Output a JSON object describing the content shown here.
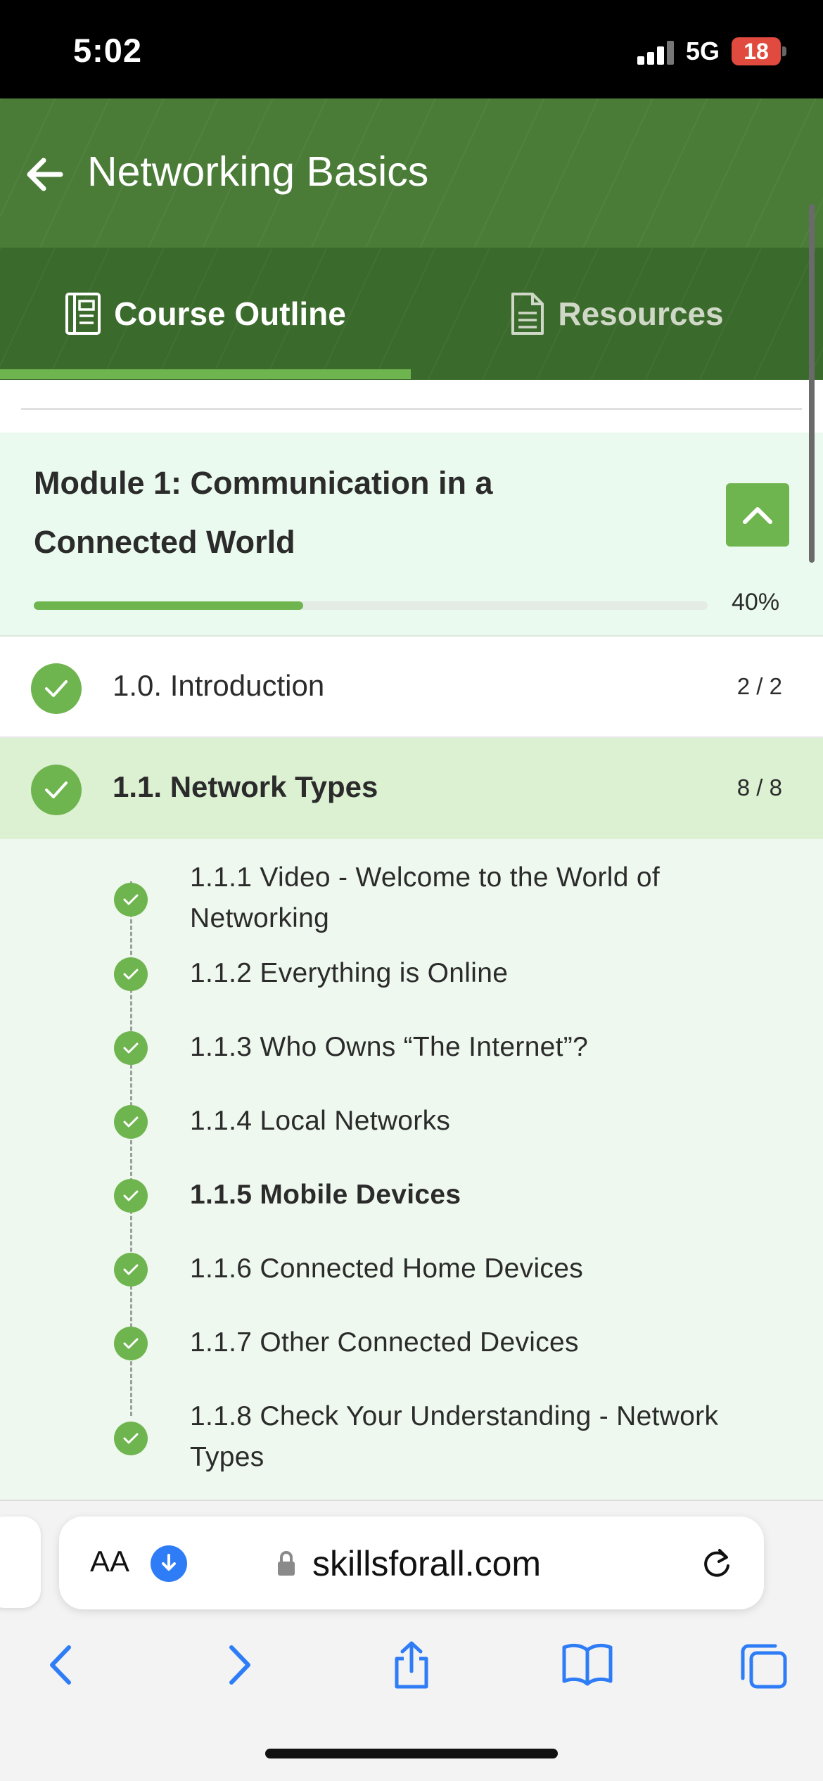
{
  "status_bar": {
    "time": "5:02",
    "network": "5G",
    "battery": "18"
  },
  "header": {
    "title": "Networking Basics"
  },
  "tabs": [
    {
      "label": "Course Outline",
      "icon": "course-outline-icon",
      "active": true
    },
    {
      "label": "Resources",
      "icon": "document-icon",
      "active": false
    }
  ],
  "module": {
    "title": "Module 1: Communication in a Connected World",
    "progress_percent": 40,
    "progress_label": "40%"
  },
  "sections": [
    {
      "title": "1.0. Introduction",
      "count": "2 / 2",
      "completed": true
    },
    {
      "title": "1.1. Network Types",
      "count": "8 / 8",
      "completed": true,
      "expanded": true
    }
  ],
  "sub_items": [
    {
      "label": "1.1.1 Video - Welcome to the World of Networking",
      "completed": true
    },
    {
      "label": "1.1.2 Everything is Online",
      "completed": true
    },
    {
      "label": "1.1.3 Who Owns “The Internet”?",
      "completed": true
    },
    {
      "label": "1.1.4 Local Networks",
      "completed": true
    },
    {
      "label": "1.1.5 Mobile Devices",
      "completed": true,
      "current": true
    },
    {
      "label": "1.1.6 Connected Home Devices",
      "completed": true
    },
    {
      "label": "1.1.7 Other Connected Devices",
      "completed": true
    },
    {
      "label": "1.1.8 Check Your Understanding - Network Types",
      "completed": true
    }
  ],
  "browser": {
    "text_size_label": "AA",
    "url": "skillsforall.com",
    "toolbar": [
      "back-icon",
      "forward-icon",
      "share-icon",
      "bookmarks-icon",
      "tabs-icon"
    ]
  },
  "colors": {
    "header": "#4a7c37",
    "accent": "#6fb54f",
    "module_bg": "#eafaee",
    "active_section_bg": "#dcf0d2"
  }
}
